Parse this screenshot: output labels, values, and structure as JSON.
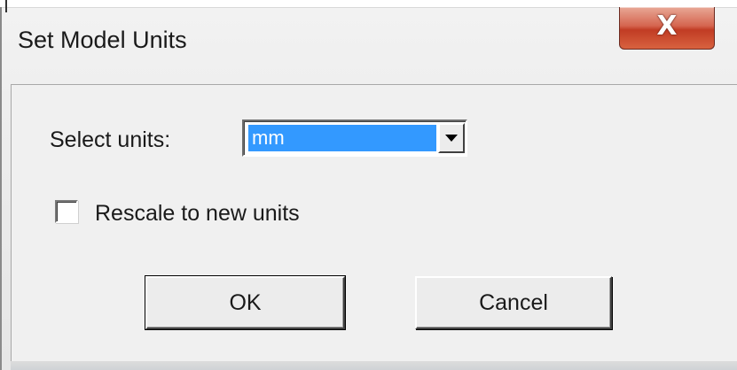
{
  "window": {
    "title": "Set Model Units",
    "close_glyph": "X"
  },
  "units": {
    "label": "Select units:",
    "selected_value": "mm",
    "dropdown_icon": "triangle-down-icon"
  },
  "rescale": {
    "label": "Rescale to new units",
    "checked": false
  },
  "buttons": {
    "ok_label": "OK",
    "cancel_label": "Cancel"
  },
  "colors": {
    "selection_highlight": "#3399ff",
    "close_button": "#c13c24",
    "dialog_background": "#f0f0f0"
  }
}
